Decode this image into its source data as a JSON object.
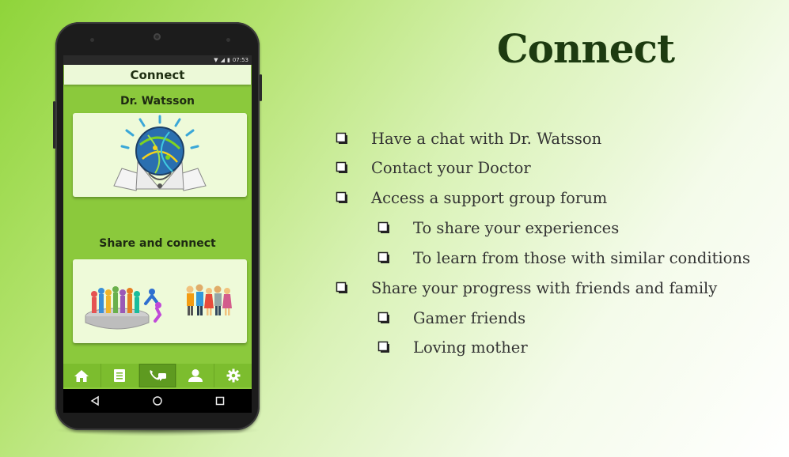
{
  "slide": {
    "title": "Connect",
    "bullets": [
      {
        "text": "Have a chat with Dr. Watsson",
        "level": 1
      },
      {
        "text": "Contact your Doctor",
        "level": 1
      },
      {
        "text": "Access a support group forum",
        "level": 1
      },
      {
        "text": "To share your experiences",
        "level": 2
      },
      {
        "text": "To learn from those with similar conditions",
        "level": 2
      },
      {
        "text": "Share your progress with friends and family",
        "level": 1
      },
      {
        "text": "Gamer friends",
        "level": 2
      },
      {
        "text": "Loving mother",
        "level": 2
      }
    ]
  },
  "phone": {
    "status_time": "07:53",
    "app_title": "Connect",
    "section1_title": "Dr. Watsson",
    "section2_title": "Share and connect",
    "tabs": [
      {
        "icon": "home-icon"
      },
      {
        "icon": "document-icon"
      },
      {
        "icon": "phone-chat-icon",
        "active": true
      },
      {
        "icon": "person-icon"
      },
      {
        "icon": "gear-icon"
      }
    ],
    "softkeys": [
      "back-icon",
      "home-circle-icon",
      "recents-icon"
    ]
  },
  "colors": {
    "title": "#1d3b10",
    "app_green": "#8bc93c",
    "card_bg": "#eefad9"
  }
}
